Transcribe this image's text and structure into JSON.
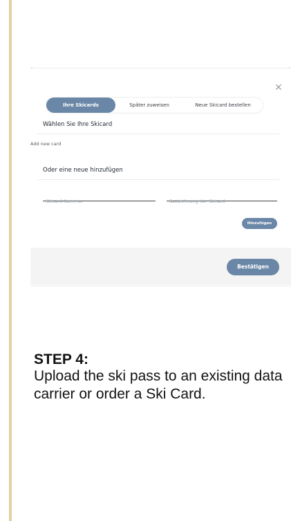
{
  "dialog": {
    "tabs": [
      {
        "label": "Ihre Skicards",
        "active": true
      },
      {
        "label": "Später zuweisen",
        "active": false
      },
      {
        "label": "Neue Skicard bestellen",
        "active": false
      }
    ],
    "close_icon": "close-icon",
    "select_heading": "Wählen Sie Ihre Skicard",
    "add_new_card": "Add new card",
    "new_heading": "Oder eine neue hinzufügen",
    "fields": {
      "number_placeholder": "Skicard-Nummer",
      "name_placeholder": "Bezeichnung der Skicard"
    },
    "add_button": "Hinzufügen",
    "confirm_button": "Bestätigen"
  },
  "step": {
    "title": "STEP 4:",
    "description": "Upload the ski pass to an existing data carrier or order a Ski Card."
  },
  "colors": {
    "accent": "#6a87a7",
    "side_bar": "#e2cfa2",
    "footer_bg": "#f4f4f4"
  }
}
